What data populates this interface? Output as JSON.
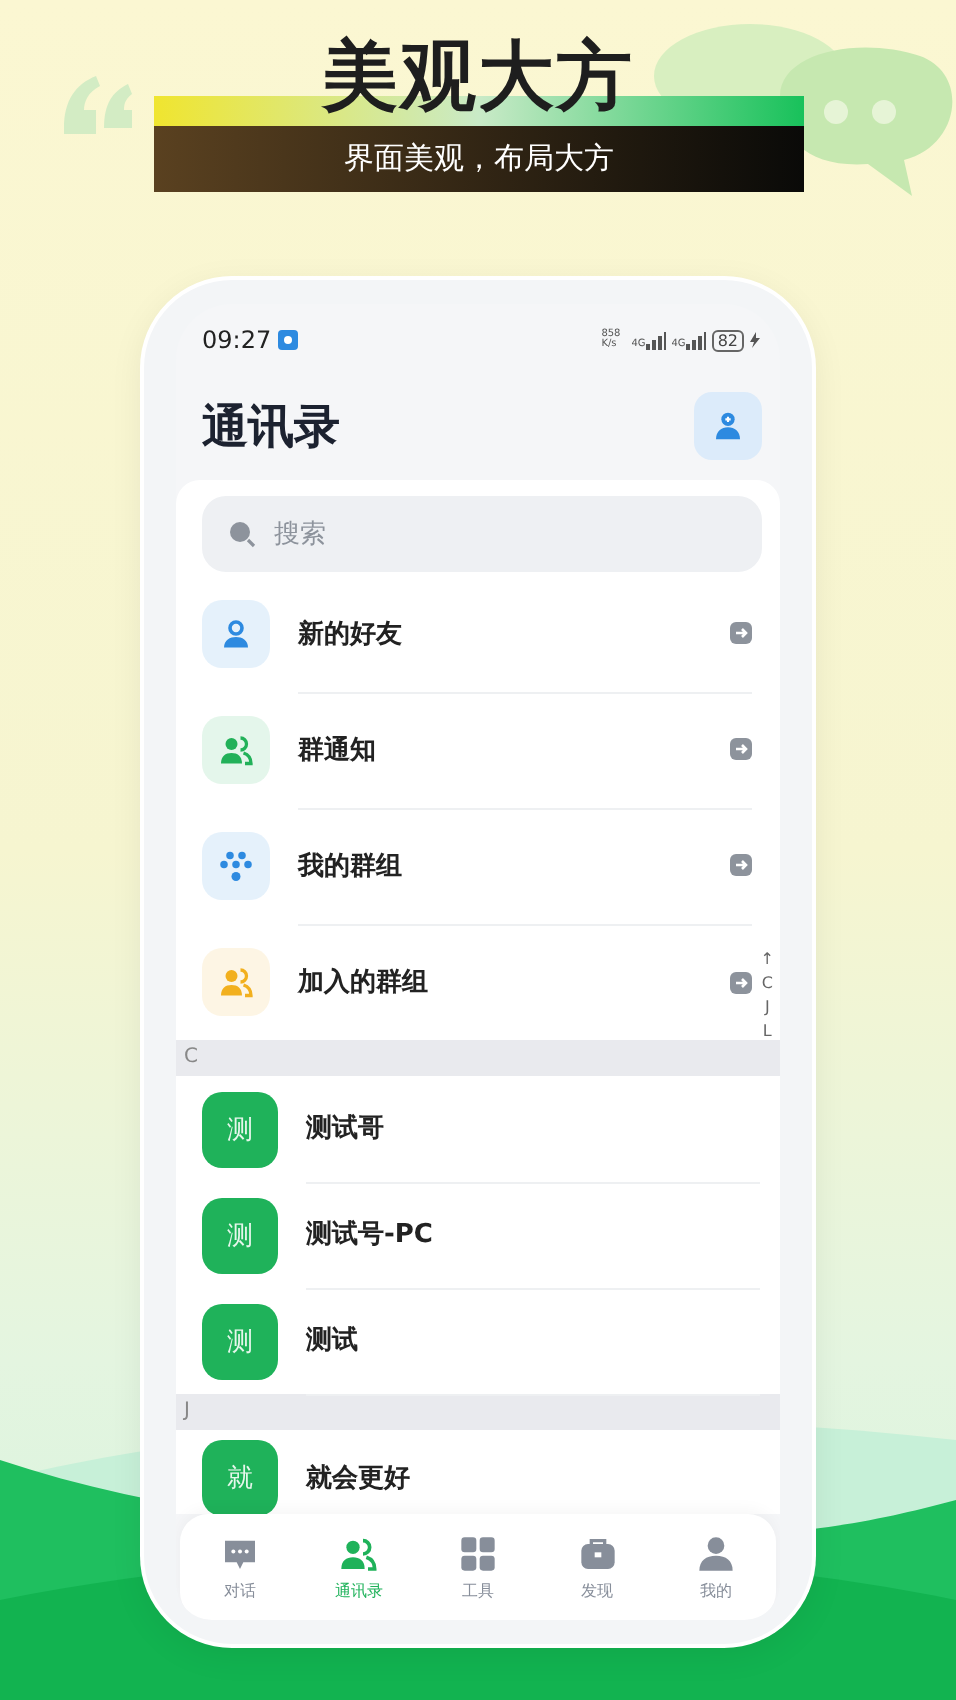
{
  "banner": {
    "title": "美观大方",
    "subtitle": "界面美观，布局大方"
  },
  "status_bar": {
    "time": "09:27",
    "net_speed": "858 K/s",
    "network_types": [
      "4G",
      "4G"
    ],
    "battery": "82"
  },
  "header": {
    "title": "通讯录"
  },
  "search": {
    "placeholder": "搜索"
  },
  "entries": [
    {
      "label": "新的好友",
      "kind": "person",
      "color": "#2d8ae0"
    },
    {
      "label": "群通知",
      "kind": "group",
      "color": "#22b159"
    },
    {
      "label": "我的群组",
      "kind": "cluster",
      "color": "#2d8ae0"
    },
    {
      "label": "加入的群组",
      "kind": "group",
      "color": "#f2b01e"
    }
  ],
  "index_bar": [
    "↑",
    "C",
    "J",
    "L"
  ],
  "sections": [
    {
      "letter": "C",
      "contacts": [
        {
          "avatar": "测",
          "name": "测试哥"
        },
        {
          "avatar": "测",
          "name": "测试号-PC"
        },
        {
          "avatar": "测",
          "name": "测试"
        }
      ]
    },
    {
      "letter": "J",
      "contacts": [
        {
          "avatar": "就",
          "name": "就会更好"
        }
      ]
    }
  ],
  "tabs": [
    {
      "label": "对话",
      "kind": "chat",
      "selected": false
    },
    {
      "label": "通讯录",
      "kind": "contacts",
      "selected": true
    },
    {
      "label": "工具",
      "kind": "tools",
      "selected": false
    },
    {
      "label": "发现",
      "kind": "discover",
      "selected": false
    },
    {
      "label": "我的",
      "kind": "me",
      "selected": false
    }
  ]
}
